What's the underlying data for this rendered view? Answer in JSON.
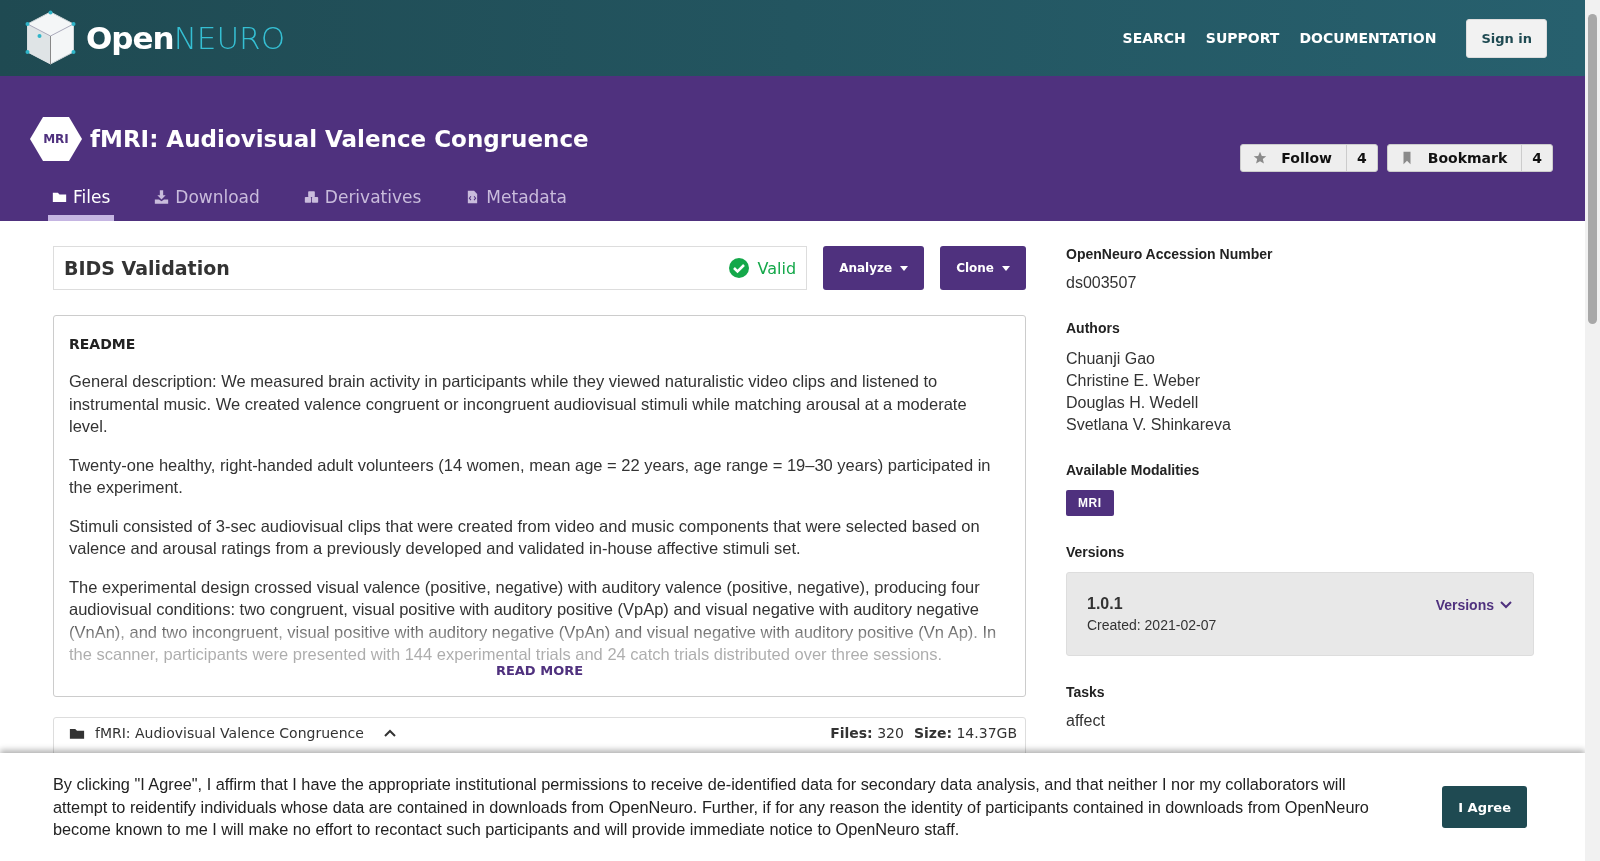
{
  "header": {
    "logo": {
      "first": "Open",
      "second": "NEURO"
    },
    "nav": [
      "SEARCH",
      "SUPPORT",
      "DOCUMENTATION"
    ],
    "sign_in": "Sign in"
  },
  "dataset": {
    "modality_badge": "MRI",
    "title": "fMRI: Audiovisual Valence Congruence",
    "counters": [
      {
        "kind": "follow",
        "label": "Follow",
        "count": "4"
      },
      {
        "kind": "bookmark",
        "label": "Bookmark",
        "count": "4"
      }
    ]
  },
  "tabs": [
    {
      "kind": "folder",
      "label": "Files",
      "selected": true
    },
    {
      "kind": "download",
      "label": "Download",
      "selected": false
    },
    {
      "kind": "cubes",
      "label": "Derivatives",
      "selected": false
    },
    {
      "kind": "code",
      "label": "Metadata",
      "selected": false
    }
  ],
  "validation": {
    "title": "BIDS Validation",
    "status": "Valid"
  },
  "actions": [
    "Analyze",
    "Clone"
  ],
  "readme": {
    "heading": "README",
    "paragraphs": [
      "General description: We measured brain activity in participants while they viewed naturalistic video clips and listened to instrumental music. We created valence congruent or incongruent audiovisual stimuli while matching arousal at a moderate level.",
      "Twenty-one healthy, right-handed adult volunteers (14 women, mean age = 22 years, age range = 19–30 years) participated in the experiment.",
      "Stimuli consisted of 3-sec audiovisual clips that were created from video and music components that were selected based on valence and arousal ratings from a previously developed and validated in-house affective stimuli set.",
      "The experimental design crossed visual valence (positive, negative) with auditory valence (positive, negative), producing four audiovisual conditions: two congruent, visual positive with auditory positive (VpAp) and visual negative with auditory negative (VnAn), and two incongruent, visual positive with auditory negative (VpAn) and visual negative with auditory positive (Vn Ap). In the scanner, participants were presented with 144 experimental trials and 24 catch trials distributed over three sessions."
    ],
    "read_more": "READ MORE"
  },
  "file_tree": {
    "name": "fMRI: Audiovisual Valence Congruence",
    "expanded": true,
    "files_label": "Files:",
    "files": "320",
    "size_label": "Size:",
    "size": "14.37GB"
  },
  "sidebar": {
    "accession": {
      "label": "OpenNeuro Accession Number",
      "value": "ds003507"
    },
    "authors": {
      "label": "Authors",
      "items": [
        "Chuanji Gao",
        "Christine E. Weber",
        "Douglas H. Wedell",
        "Svetlana V. Shinkareva"
      ]
    },
    "modalities": {
      "label": "Available Modalities",
      "items": [
        "MRI"
      ]
    },
    "versions": {
      "label": "Versions",
      "current": "1.0.1",
      "created": "Created: 2021-02-07",
      "menu": "Versions"
    },
    "tasks": {
      "label": "Tasks",
      "value": "affect"
    }
  },
  "consent": {
    "text": "By clicking \"I Agree\", I affirm that I have the appropriate institutional permissions to receive de-identified data for secondary data analysis, and that neither I nor my collaborators will attempt to reidentify individuals whose data are contained in downloads from OpenNeuro. Further, if for any reason the identity of participants contained in downloads from OpenNeuro become known to me I will make no effort to recontact such participants and will provide immediate notice to OpenNeuro staff.",
    "button": "I Agree"
  }
}
